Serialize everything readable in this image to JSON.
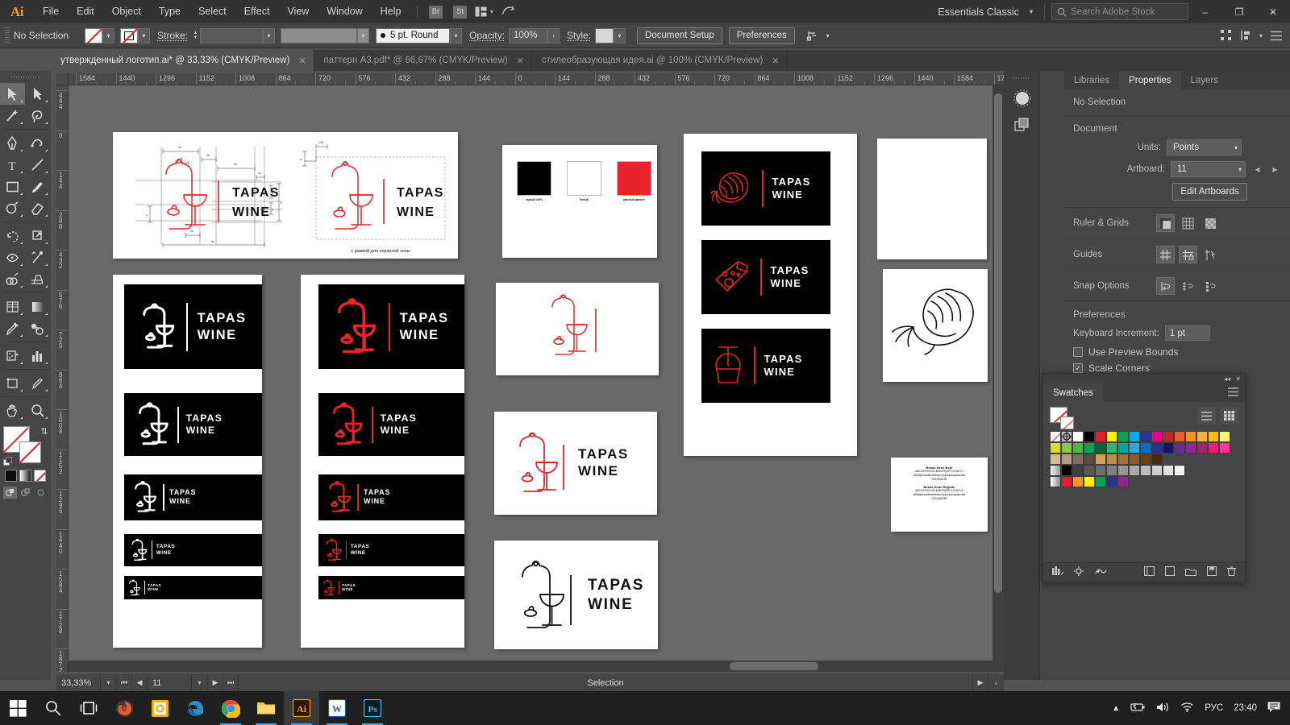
{
  "app": {
    "name": "Adobe Illustrator",
    "logo_text": "Ai",
    "menus": [
      "File",
      "Edit",
      "Object",
      "Type",
      "Select",
      "Effect",
      "View",
      "Window",
      "Help"
    ],
    "bridge_label": "Br",
    "stock_label": "St",
    "arrange_icon": "arrange-documents-icon",
    "sync_icon": "cc-sync-icon",
    "workspace": "Essentials Classic",
    "search_placeholder": "Search Adobe Stock",
    "search_icon": "search-icon",
    "window_minimize": "–",
    "window_restore": "❐",
    "window_close": "✕"
  },
  "controlbar": {
    "selection_state": "No Selection",
    "fill_label": "fill-swatch",
    "stroke_text": "Stroke:",
    "stroke_weight": "",
    "brush_def": "5 pt. Round",
    "opacity_label": "Opacity:",
    "opacity_value": "100%",
    "style_label": "Style:",
    "document_setup": "Document Setup",
    "preferences": "Preferences",
    "align_icon": "align-to-icon",
    "right_icons": [
      "transform-grid-icon",
      "arrange-icon",
      "options-menu-icon"
    ]
  },
  "tabs": [
    {
      "title": "утвержденный логотип.ai* @ 33,33% (CMYK/Preview)",
      "active": true
    },
    {
      "title": "паттерн A3.pdf* @ 66,67% (CMYK/Preview)",
      "active": false
    },
    {
      "title": "стилеобразующая идея.ai @ 100% (CMYK/Preview)",
      "active": false
    }
  ],
  "toolbar": {
    "tools": [
      {
        "name": "selection-tool",
        "glyph": "selection",
        "selected": true
      },
      {
        "name": "direct-selection-tool",
        "glyph": "direct",
        "selected": false
      },
      {
        "name": "magic-wand-tool",
        "glyph": "wand",
        "selected": false
      },
      {
        "name": "lasso-tool",
        "glyph": "lasso",
        "selected": false
      },
      {
        "name": "pen-tool",
        "glyph": "pen",
        "selected": false
      },
      {
        "name": "curvature-tool",
        "glyph": "curvature",
        "selected": false
      },
      {
        "name": "type-tool",
        "glyph": "type",
        "selected": false
      },
      {
        "name": "line-segment-tool",
        "glyph": "line",
        "selected": false
      },
      {
        "name": "rectangle-tool",
        "glyph": "rect",
        "selected": false
      },
      {
        "name": "paintbrush-tool",
        "glyph": "brush",
        "selected": false
      },
      {
        "name": "shaper-tool",
        "glyph": "shaper",
        "selected": false
      },
      {
        "name": "eraser-tool",
        "glyph": "eraser",
        "selected": false
      },
      {
        "name": "rotate-tool",
        "glyph": "rotate",
        "selected": false
      },
      {
        "name": "scale-tool",
        "glyph": "scale",
        "selected": false
      },
      {
        "name": "width-tool",
        "glyph": "width",
        "selected": false
      },
      {
        "name": "free-transform-tool",
        "glyph": "freetransform",
        "selected": false
      },
      {
        "name": "shape-builder-tool",
        "glyph": "shapebuilder",
        "selected": false
      },
      {
        "name": "perspective-grid-tool",
        "glyph": "perspective",
        "selected": false
      },
      {
        "name": "mesh-tool",
        "glyph": "mesh",
        "selected": false
      },
      {
        "name": "gradient-tool",
        "glyph": "gradient",
        "selected": false
      },
      {
        "name": "eyedropper-tool",
        "glyph": "eyedropper",
        "selected": false
      },
      {
        "name": "blend-tool",
        "glyph": "blend",
        "selected": false
      },
      {
        "name": "symbol-sprayer-tool",
        "glyph": "symbol",
        "selected": false
      },
      {
        "name": "column-graph-tool",
        "glyph": "graph",
        "selected": false
      },
      {
        "name": "artboard-tool",
        "glyph": "artboard",
        "selected": false
      },
      {
        "name": "slice-tool",
        "glyph": "slice",
        "selected": false
      },
      {
        "name": "hand-tool",
        "glyph": "hand",
        "selected": false
      },
      {
        "name": "zoom-tool",
        "glyph": "zoom",
        "selected": false
      }
    ],
    "fill_none": true,
    "stroke_none": true,
    "color_modes": [
      "color-swatch-black",
      "gradient-swatch",
      "none-swatch"
    ],
    "draw_modes": [
      "draw-normal",
      "draw-behind",
      "draw-inside"
    ]
  },
  "rulers": {
    "unit_hint": "Points",
    "h_labels": [
      "1584",
      "1440",
      "1296",
      "1152",
      "1008",
      "864",
      "720",
      "576",
      "432",
      "288",
      "144",
      "0",
      "144",
      "288",
      "432",
      "576",
      "720",
      "864",
      "1008",
      "1152",
      "1296",
      "1440",
      "1584",
      "1728"
    ],
    "v_labels": [
      "4 4 4",
      "0",
      "1 4 4",
      "2 8 8",
      "4 3 2",
      "5 7 6",
      "7 2 0",
      "8 6 4",
      "1 0 0 8",
      "1 1 5 2",
      "1 2 9 6",
      "1 4 4 0",
      "1 5 8 4",
      "1 7 2 8",
      "1 8 7 2"
    ]
  },
  "artwork": {
    "brand": "TAPAS WINE",
    "brand_line1": "TAPAS",
    "brand_line2": "WINE",
    "caption_safezone": "с рамкой для охранной зоны",
    "colors": {
      "red": "#e8232a",
      "black": "#000000",
      "white": "#ffffff"
    },
    "palette_swatches": [
      {
        "name": "black-swatch",
        "color": "#000000",
        "caption": "черный 100%"
      },
      {
        "name": "white-swatch",
        "color": "#ffffff",
        "caption": "белый"
      },
      {
        "name": "red-swatch",
        "color": "#e8232a",
        "caption": "красный pantone"
      }
    ],
    "icon_variants": [
      "cutting-board-wine-glass",
      "shrimp",
      "cheese-wedge",
      "inverted-wine-glass"
    ],
    "construction_marks": [
      "1a",
      "2a",
      "3a",
      "4a",
      "5a",
      "x",
      "y",
      "b"
    ]
  },
  "properties": {
    "tabs": [
      {
        "label": "Libraries",
        "active": false
      },
      {
        "label": "Properties",
        "active": true
      },
      {
        "label": "Layers",
        "active": false
      }
    ],
    "selection_state": "No Selection",
    "document_title": "Document",
    "units_label": "Units:",
    "units_value": "Points",
    "artboard_label": "Artboard:",
    "artboard_value": "11",
    "prev_artboard_icon": "prev-artboard-icon",
    "next_artboard_icon": "next-artboard-icon",
    "edit_artboards": "Edit Artboards",
    "ruler_grids_label": "Ruler & Grids",
    "ruler_grids_icons": [
      "show-rulers-icon",
      "show-grid-icon",
      "show-transparency-grid-icon"
    ],
    "guides_label": "Guides",
    "guides_icons": [
      "show-guides-icon",
      "lock-guides-icon",
      "smart-guides-icon"
    ],
    "snap_label": "Snap Options",
    "snap_icons": [
      "snap-to-point-icon",
      "snap-to-grid-icon",
      "snap-to-pixel-icon"
    ],
    "preferences_title": "Preferences",
    "keyboard_increment_label": "Keyboard Increment:",
    "keyboard_increment_value": "1 pt",
    "use_preview_bounds": "Use Preview Bounds",
    "use_preview_bounds_checked": false,
    "scale_corners": "Scale Corners",
    "scale_corners_checked": true
  },
  "swatches_panel": {
    "title": "Swatches",
    "collapse_icon": "collapse-icon",
    "close_icon": "close-icon",
    "menu_icon": "panel-menu-icon",
    "view_list_icon": "list-view-icon",
    "view_grid_icon": "grid-view-icon",
    "rows": [
      [
        "none",
        "registration",
        "#ffffff",
        "#000000",
        "#ec1c24",
        "#fff200",
        "#00a651",
        "#00aeef",
        "#2e3192",
        "#ec008c",
        "#c1272d",
        "#f15a29",
        "#f7941e",
        "#fbb040",
        "#fdb913",
        "#fff568"
      ],
      [
        "#d7df23",
        "#8dc63f",
        "#4cb748",
        "#00a651",
        "#006838",
        "#2bb673",
        "#00a79d",
        "#29abe2",
        "#0071bc",
        "#2e3192",
        "#1b1464",
        "#662d91",
        "#92278f",
        "#a6216b",
        "#ed1e79",
        "#ff3399"
      ],
      [
        "#d3bc9a",
        "#b09b89",
        "#7d6f63",
        "#5c4a3c",
        "#d9a05b",
        "#c08a4b",
        "#a3703a",
        "#8a5a2b",
        "#6b3f14",
        "#4a2a10"
      ],
      [
        "gradient",
        "#000000",
        "#3f3f3f",
        "#595959",
        "#6e6e6e",
        "#808080",
        "#949494",
        "#a9a9a9",
        "#bdbdbd",
        "#d1d1d1",
        "#e3e3e3",
        "#f2f2f2"
      ],
      [
        "gradient2",
        "#ed1c24",
        "#f7941e",
        "#fff200",
        "#00a651",
        "#2e3192",
        "#92278f"
      ]
    ],
    "footer_icons": [
      "swatch-libraries-icon",
      "show-swatch-kinds-icon",
      "color-group-icon",
      "new-color-group-icon",
      "new-swatch-icon",
      "delete-swatch-icon"
    ]
  },
  "statusbar": {
    "zoom": "33,33%",
    "first_icon": "first-artboard-icon",
    "prev_icon": "prev-artboard-icon",
    "artboard": "11",
    "next_icon": "next-artboard-icon",
    "last_icon": "last-artboard-icon",
    "status_text": "Selection"
  },
  "taskbar": {
    "items": [
      {
        "name": "start-button",
        "glyph": "windows",
        "running": false,
        "active": false
      },
      {
        "name": "search-button",
        "glyph": "search",
        "running": false,
        "active": false
      },
      {
        "name": "task-view-button",
        "glyph": "taskview",
        "running": false,
        "active": false
      },
      {
        "name": "firefox-taskbar-icon",
        "glyph": "firefox",
        "running": false,
        "active": false
      },
      {
        "name": "office-taskbar-icon",
        "glyph": "office",
        "running": false,
        "active": false
      },
      {
        "name": "edge-taskbar-icon",
        "glyph": "edge",
        "running": false,
        "active": false
      },
      {
        "name": "chrome-taskbar-icon",
        "glyph": "chrome",
        "running": true,
        "active": false
      },
      {
        "name": "file-explorer-taskbar-icon",
        "glyph": "explorer",
        "running": true,
        "active": false
      },
      {
        "name": "illustrator-taskbar-icon",
        "glyph": "ai",
        "running": true,
        "active": true
      },
      {
        "name": "word-taskbar-icon",
        "glyph": "word",
        "running": true,
        "active": false
      },
      {
        "name": "photoshop-taskbar-icon",
        "glyph": "ps",
        "running": true,
        "active": false
      }
    ],
    "tray": {
      "chevron": "show-hidden-icons",
      "battery": "battery-icon",
      "volume": "volume-icon",
      "network": "wifi-icon",
      "language": "РУС",
      "clock": "23:40",
      "notifications": "notifications-icon"
    }
  }
}
